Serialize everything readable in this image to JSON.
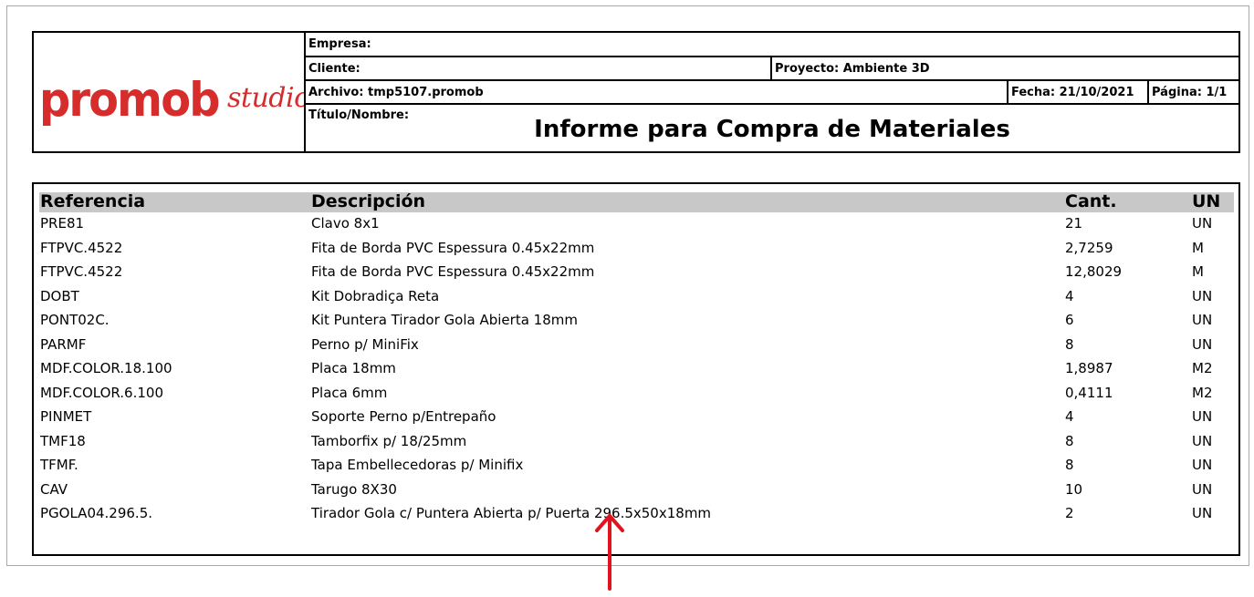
{
  "logo": {
    "brand": "promob",
    "sub": "studio"
  },
  "header": {
    "empresa_label": "Empresa:",
    "cliente_label": "Cliente:",
    "proyecto_label": "Proyecto: Ambiente 3D",
    "archivo_label": "Archivo: tmp5107.promob",
    "fecha_label": "Fecha: 21/10/2021",
    "pagina_label": "Página: 1/1",
    "titulo_label": "Título/Nombre:",
    "titulo": "Informe para Compra de Materiales"
  },
  "table": {
    "headers": {
      "ref": "Referencia",
      "desc": "Descripción",
      "cant": "Cant.",
      "un": "UN"
    },
    "rows": [
      {
        "ref": "PRE81",
        "desc": "Clavo 8x1",
        "cant": "21",
        "un": "UN"
      },
      {
        "ref": "FTPVC.4522",
        "desc": "Fita de Borda PVC Espessura 0.45x22mm",
        "cant": "2,7259",
        "un": "M"
      },
      {
        "ref": "FTPVC.4522",
        "desc": "Fita de Borda PVC Espessura 0.45x22mm",
        "cant": "12,8029",
        "un": "M"
      },
      {
        "ref": "DOBT",
        "desc": "Kit Dobradiça Reta",
        "cant": "4",
        "un": "UN"
      },
      {
        "ref": "PONT02C.",
        "desc": "Kit Puntera Tirador Gola Abierta 18mm",
        "cant": "6",
        "un": "UN"
      },
      {
        "ref": "PARMF",
        "desc": "Perno p/ MiniFix",
        "cant": "8",
        "un": "UN"
      },
      {
        "ref": "MDF.COLOR.18.100",
        "desc": "Placa  18mm",
        "cant": "1,8987",
        "un": "M2"
      },
      {
        "ref": "MDF.COLOR.6.100",
        "desc": "Placa  6mm",
        "cant": "0,4111",
        "un": "M2"
      },
      {
        "ref": "PINMET",
        "desc": "Soporte Perno p/Entrepaño",
        "cant": "4",
        "un": "UN"
      },
      {
        "ref": "TMF18",
        "desc": "Tamborfix p/ 18/25mm",
        "cant": "8",
        "un": "UN"
      },
      {
        "ref": "TFMF.",
        "desc": "Tapa Embellecedoras p/ Minifix",
        "cant": "8",
        "un": "UN"
      },
      {
        "ref": "CAV",
        "desc": "Tarugo 8X30",
        "cant": "10",
        "un": "UN"
      },
      {
        "ref": "PGOLA04.296.5.",
        "desc": "Tirador Gola c/ Puntera Abierta p/ Puerta 296.5x50x18mm",
        "cant": "2",
        "un": "UN"
      }
    ]
  },
  "annotation": {
    "arrow_color": "#e0141e"
  }
}
